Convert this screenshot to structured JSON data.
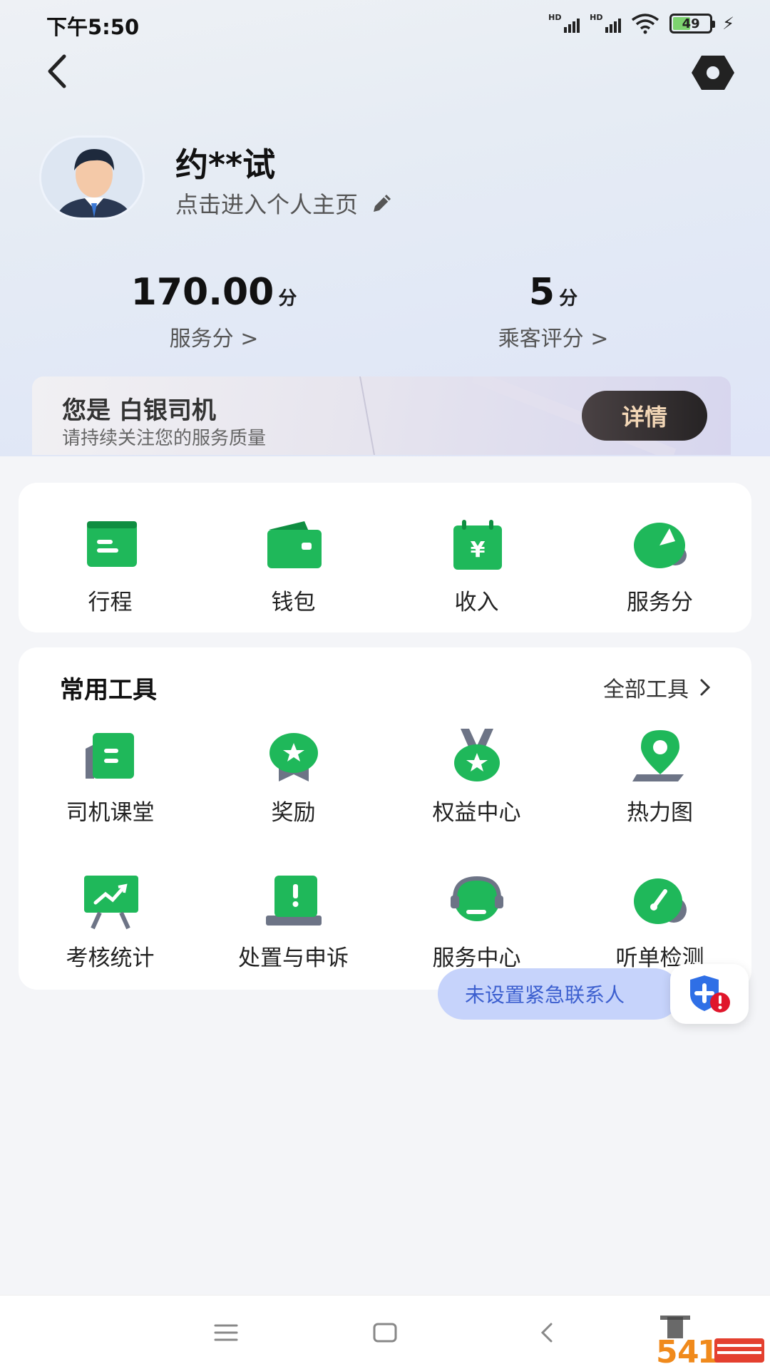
{
  "status_bar": {
    "time": "下午5:50",
    "battery": "49",
    "signal_label": "HD"
  },
  "profile": {
    "username": "约**试",
    "link_text": "点击进入个人主页"
  },
  "stats": {
    "service": {
      "value": "170.00",
      "unit": "分",
      "label": "服务分 >"
    },
    "rating": {
      "value": "5",
      "unit": "分",
      "label": "乘客评分 >"
    }
  },
  "level": {
    "title": "您是 白银司机",
    "subtitle": "请持续关注您的服务质量",
    "detail_button": "详情"
  },
  "main_grid": [
    {
      "label": "行程",
      "icon": "trip-icon"
    },
    {
      "label": "钱包",
      "icon": "wallet-icon"
    },
    {
      "label": "收入",
      "icon": "income-icon"
    },
    {
      "label": "服务分",
      "icon": "service-score-icon"
    }
  ],
  "tools": {
    "title": "常用工具",
    "all_link": "全部工具",
    "items": [
      {
        "label": "司机课堂",
        "icon": "driver-class-icon"
      },
      {
        "label": "奖励",
        "icon": "reward-icon"
      },
      {
        "label": "权益中心",
        "icon": "benefits-icon"
      },
      {
        "label": "热力图",
        "icon": "heatmap-icon"
      },
      {
        "label": "考核统计",
        "icon": "assessment-icon"
      },
      {
        "label": "处置与申诉",
        "icon": "appeal-icon"
      },
      {
        "label": "服务中心",
        "icon": "service-center-icon"
      },
      {
        "label": "听单检测",
        "icon": "order-check-icon"
      }
    ]
  },
  "emergency": {
    "text": "未设置紧急联系人"
  },
  "colors": {
    "accent_green": "#1fb85a",
    "pill_blue": "#c6d3fb",
    "pill_text": "#3c5fcf",
    "detail_gold": "#f2d6b6"
  }
}
